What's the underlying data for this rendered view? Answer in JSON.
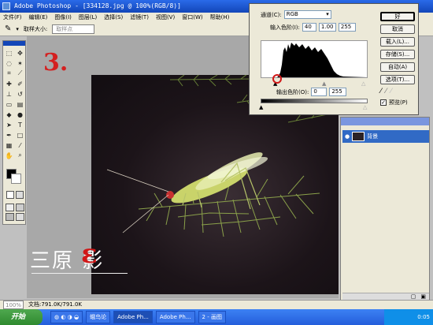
{
  "window": {
    "title": "Adobe Photoshop - [334128.jpg @ 100%(RGB/8)]"
  },
  "menu": [
    "文件(F)",
    "编辑(E)",
    "图像(I)",
    "图层(L)",
    "选择(S)",
    "滤镜(T)",
    "视图(V)",
    "窗口(W)",
    "帮助(H)"
  ],
  "options": {
    "sample_label": "取样大小:",
    "sample_value": "取样点"
  },
  "annotation": {
    "step": "3."
  },
  "watermark": {
    "text": "三原  影",
    "mark": "ε"
  },
  "levels": {
    "channel_label": "通道(C):",
    "channel_value": "RGB",
    "input_label": "输入色阶(I):",
    "input_black": "40",
    "input_gamma": "1.00",
    "input_white": "255",
    "output_label": "输出色阶(O):",
    "output_black": "0",
    "output_white": "255",
    "buttons": [
      "好",
      "取消",
      "载入(L)...",
      "存储(S)...",
      "自动(A)",
      "选项(T)..."
    ],
    "preview_label": "预览(P)",
    "preview_checked": true
  },
  "layers": {
    "layer_name": "背景"
  },
  "status": {
    "zoom": "100%",
    "doc": "文档:791.0K/791.0K"
  },
  "taskbar": {
    "start_label": "开始",
    "tasks": [
      "蛾鸟论",
      "Adobe Ph...",
      "Adobe Ph...",
      "2 - 画图"
    ],
    "clock": "0:05"
  }
}
